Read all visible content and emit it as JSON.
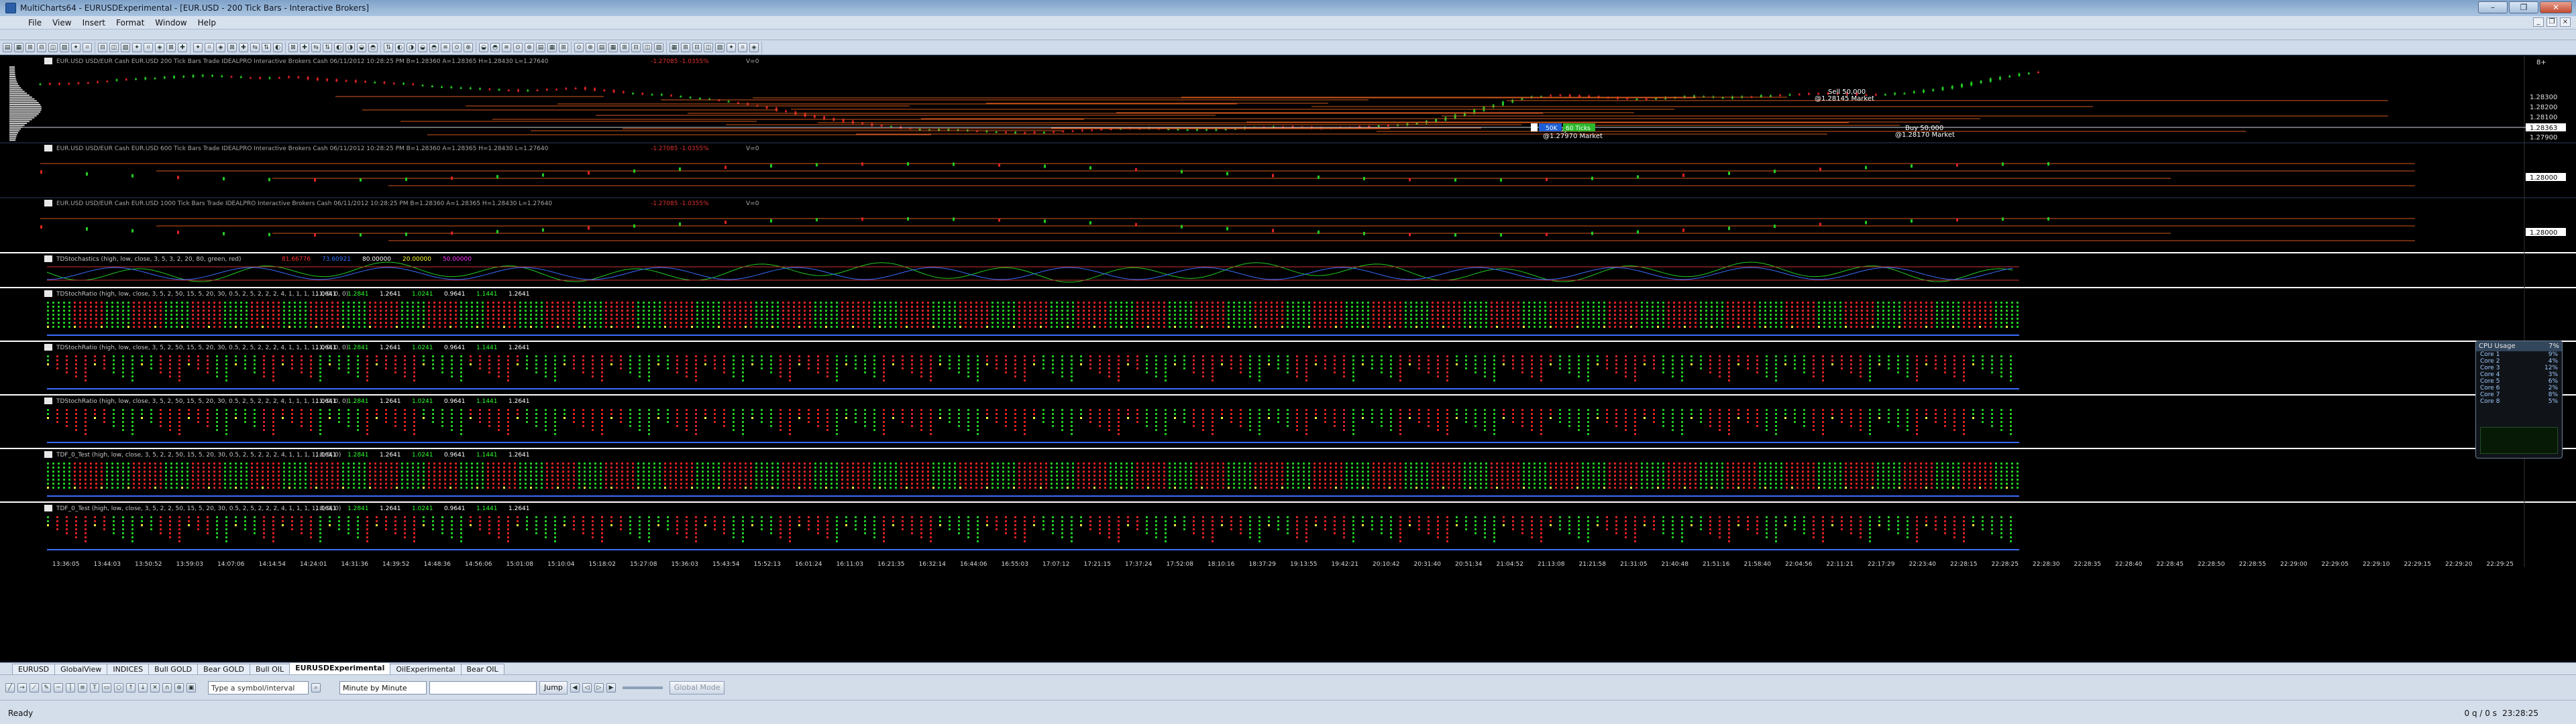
{
  "app": {
    "title": "MultiCharts64 - EURUSDExperimental - [EUR.USD - 200 Tick Bars - Interactive Brokers]",
    "window_buttons": [
      "–",
      "❐",
      "✕"
    ]
  },
  "menu": [
    "File",
    "View",
    "Insert",
    "Format",
    "Window",
    "Help"
  ],
  "chart_data": {
    "type": "table",
    "symbol": "EUR.USD",
    "panes": [
      {
        "name": "price-200",
        "header": "EUR.USD USD/EUR Cash EUR.USD 200 Tick Bars  Trade  IDEALPRO  Interactive Brokers  Cash  06/11/2012  10:28:25 PM  B=1.28360  A=1.28365  H=1.28430  L=1.27640",
        "change": "-1.27085 -1.0355%",
        "v": "V=0"
      },
      {
        "name": "price-600",
        "header": "EUR.USD USD/EUR Cash EUR.USD 600 Tick Bars  Trade  IDEALPRO  Interactive Brokers  Cash  06/11/2012  10:28:25 PM  B=1.28360  A=1.28365  H=1.28430  L=1.27640",
        "change": "-1.27085 -1.0355%",
        "v": "V=0"
      },
      {
        "name": "price-1000",
        "header": "EUR.USD USD/EUR Cash EUR.USD 1000 Tick Bars  Trade  IDEALPRO  Interactive Brokers  Cash  06/11/2012  10:28:25 PM  B=1.28360  A=1.28365  H=1.28430  L=1.27640",
        "change": "-1.27085 -1.0355%",
        "v": "V=0"
      }
    ],
    "price_axis": {
      "pane1_ticks": [
        "1.28300",
        "1.28200",
        "1.28100",
        "1.28000",
        "1.27900"
      ],
      "pane1_current": "1.28363",
      "pane2_current": "1.28000",
      "pane3_current": "1.28000",
      "top_label": "8+"
    },
    "price_series": [
      1.2825,
      1.2826,
      1.2828,
      1.2829,
      1.283,
      1.2831,
      1.283,
      1.2829,
      1.283,
      1.2828,
      1.2827,
      1.2826,
      1.2825,
      1.2823,
      1.2822,
      1.2821,
      1.282,
      1.2821,
      1.2822,
      1.282,
      1.2818,
      1.2817,
      1.2815,
      1.2813,
      1.281,
      1.2806,
      1.2802,
      1.2799,
      1.2796,
      1.2794,
      1.2792,
      1.2792,
      1.2791,
      1.279,
      1.279,
      1.2791,
      1.2792,
      1.2793,
      1.2793,
      1.2792,
      1.2792,
      1.2793,
      1.2794,
      1.2794,
      1.2793,
      1.2794,
      1.2795,
      1.2796,
      1.2799,
      1.2804,
      1.281,
      1.2815,
      1.2817,
      1.2816,
      1.2815,
      1.2814,
      1.2815,
      1.2816,
      1.2815,
      1.2816,
      1.2817,
      1.2818,
      1.2818,
      1.2817,
      1.2818,
      1.282,
      1.2823,
      1.2827,
      1.2831,
      1.2834
    ],
    "trades": [
      {
        "label": "Sell 50,000",
        "sub": "@1.28145 Market"
      },
      {
        "label": "Buy 50,000",
        "sub": "@1.28170 Market"
      },
      {
        "label": "Buy 50,000",
        "sub": "@1.27970 Market"
      }
    ],
    "order_widget": {
      "side": "50K",
      "qty": "60 Ticks"
    },
    "indicators": [
      {
        "name": "stoch",
        "label": "TDStochastics  (high, low, close, 3, 5, 3, 2, 20, 80, green, red)",
        "values": [
          "81.66776",
          "73.60921",
          "80.00000",
          "20.00000",
          "50.00000"
        ]
      },
      {
        "name": "ratio1",
        "label": "TDStochRatio  (high, low, close, 3, 5, 2, 50, 15, 5, 20, 30, 0.5, 2, 5, 2, 2, 2, 4, 1, 1, 1, 1, 1, 0, 0, 0)",
        "values": [
          "1.0641",
          "1.2841",
          "1.2641",
          "1.0241",
          "0.9641",
          "1.1441",
          "1.2641"
        ]
      },
      {
        "name": "ratio2",
        "label": "TDStochRatio  (high, low, close, 3, 5, 2, 50, 15, 5, 20, 30, 0.5, 2, 5, 2, 2, 2, 4, 1, 1, 1, 1, 1, 0, 0, 0)",
        "values": [
          "1.0641",
          "1.2841",
          "1.2641",
          "1.0241",
          "0.9641",
          "1.1441",
          "1.2641"
        ]
      },
      {
        "name": "ratio3",
        "label": "TDStochRatio  (high, low, close, 3, 5, 2, 50, 15, 5, 20, 30, 0.5, 2, 5, 2, 2, 2, 4, 1, 1, 1, 1, 1, 0, 0, 0)",
        "values": [
          "1.0641",
          "1.2841",
          "1.2641",
          "1.0241",
          "0.9641",
          "1.1441",
          "1.2641"
        ]
      },
      {
        "name": "tdf1",
        "label": "TDF_0_Test  (high, low, close, 3, 5, 2, 2, 50, 15, 5, 20, 30, 0.5, 2, 5, 2, 2, 2, 4, 1, 1, 1, 1, 0, 0, 0)",
        "values": [
          "1.0641",
          "1.2841",
          "1.2641",
          "1.0241",
          "0.9641",
          "1.1441",
          "1.2641"
        ]
      },
      {
        "name": "tdf2",
        "label": "TDF_0_Test  (high, low, close, 3, 5, 2, 2, 50, 15, 5, 20, 30, 0.5, 2, 5, 2, 2, 2, 4, 1, 1, 1, 1, 0, 0, 0)",
        "values": [
          "1.0641",
          "1.2841",
          "1.2641",
          "1.0241",
          "0.9641",
          "1.1441",
          "1.2641"
        ]
      }
    ],
    "time_axis": [
      "13:36:05",
      "13:44:03",
      "13:50:52",
      "13:59:03",
      "14:07:06",
      "14:14:54",
      "14:24:01",
      "14:31:36",
      "14:39:52",
      "14:48:36",
      "14:56:06",
      "15:01:08",
      "15:10:04",
      "15:18:02",
      "15:27:08",
      "15:36:03",
      "15:43:54",
      "15:52:13",
      "16:01:24",
      "16:11:03",
      "16:21:35",
      "16:32:14",
      "16:44:06",
      "16:55:03",
      "17:07:12",
      "17:21:15",
      "17:37:24",
      "17:52:08",
      "18:10:16",
      "18:37:29",
      "19:13:55",
      "19:42:21",
      "20:10:42",
      "20:31:40",
      "20:51:34",
      "21:04:52",
      "21:13:08",
      "21:21:58",
      "21:31:05",
      "21:40:48",
      "21:51:16",
      "21:58:40",
      "22:04:56",
      "22:11:21",
      "22:17:29",
      "22:23:40",
      "22:28:15",
      "22:28:25",
      "22:28:30",
      "22:28:35",
      "22:28:40",
      "22:28:45",
      "22:28:50",
      "22:28:55",
      "22:29:00",
      "22:29:05",
      "22:29:10",
      "22:29:15",
      "22:29:20",
      "22:29:25"
    ],
    "grid": false
  },
  "tabs": [
    "EURUSD",
    "GlobalView",
    "INDICES",
    "Bull GOLD",
    "Bear GOLD",
    "Bull OIL",
    "EURUSDExperimental",
    "OilExperimental",
    "Bear OIL"
  ],
  "active_tab": "EURUSDExperimental",
  "drawbar": {
    "symbol_placeholder": "Type a symbol/interval",
    "interval": "Minute by Minute",
    "jump": "Jump",
    "global_mode": "Global Mode"
  },
  "status": {
    "ready": "Ready",
    "rate": "0 q / 0 s",
    "clock": "23:28:25"
  },
  "cpu": {
    "title": "CPU Usage",
    "pct": 7,
    "cores": [
      "Core 1",
      "Core 2",
      "Core 3",
      "Core 4",
      "Core 5",
      "Core 6",
      "Core 7",
      "Core 8"
    ],
    "core_pct": [
      9,
      4,
      12,
      3,
      6,
      2,
      8,
      5
    ]
  },
  "colors": {
    "bg": "#000000",
    "up": "#22cc22",
    "down": "#dd2222",
    "orderline": "#d4581e",
    "trend": "#3b6cff",
    "separator": "#ffffff"
  }
}
